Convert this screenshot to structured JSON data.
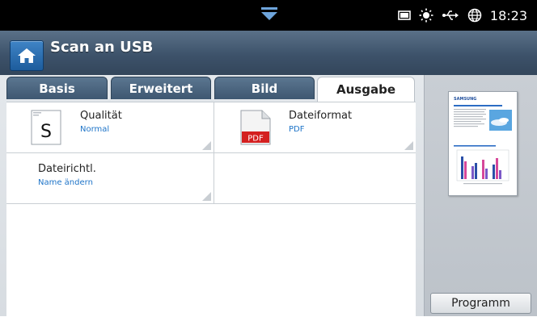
{
  "status_bar": {
    "time": "18:23",
    "icons": [
      "pull-down-arrow-icon",
      "toner-icon",
      "brightness-icon",
      "usb-icon",
      "network-globe-icon"
    ]
  },
  "header": {
    "title": "Scan an USB",
    "home_icon": "home-icon"
  },
  "tabs": [
    {
      "label": "Basis",
      "active": false
    },
    {
      "label": "Erweitert",
      "active": false
    },
    {
      "label": "Bild",
      "active": false
    },
    {
      "label": "Ausgabe",
      "active": true
    }
  ],
  "options": [
    {
      "label": "Qualität",
      "value": "Normal",
      "icon": "quality-document-icon",
      "icon_letter": "S"
    },
    {
      "label": "Dateiformat",
      "value": "PDF",
      "icon": "pdf-file-icon",
      "icon_letter": "PDF"
    },
    {
      "label": "Dateirichtl.",
      "value": "Name ändern"
    }
  ],
  "preview": {
    "logo_text": "SAMSUNG"
  },
  "program_button": "Programm",
  "colors": {
    "accent_blue": "#1e74c8",
    "title_bar": "#3d526a",
    "pdf_red": "#d42020"
  }
}
